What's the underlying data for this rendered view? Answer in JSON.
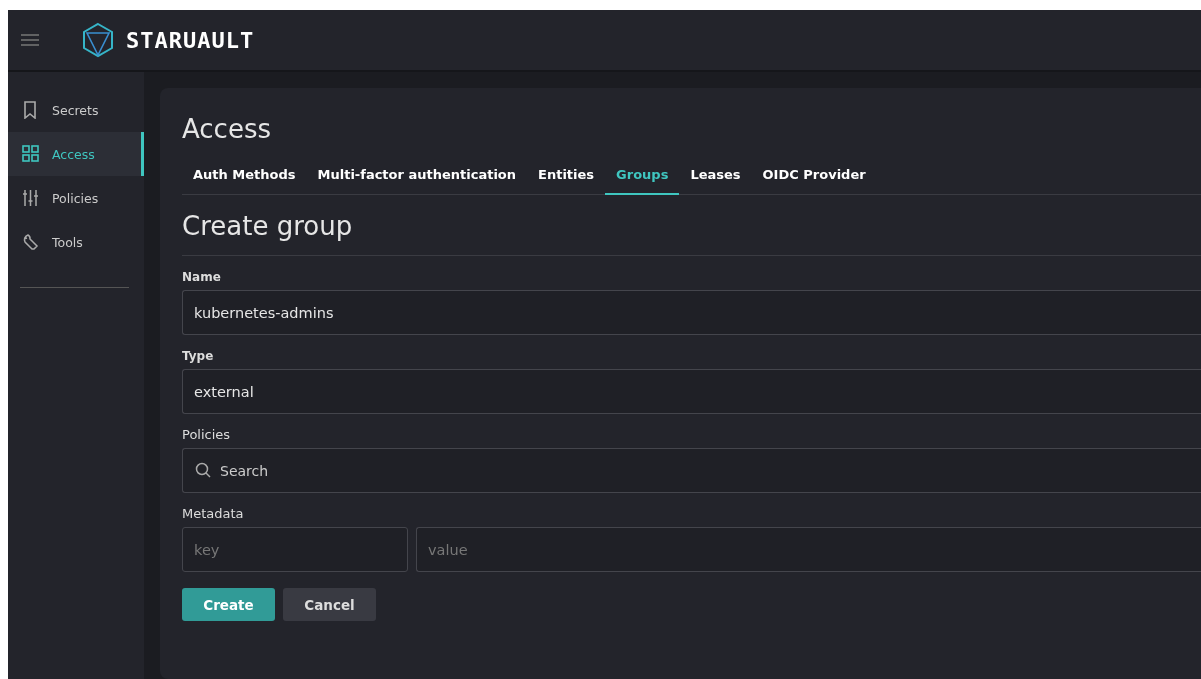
{
  "header": {
    "brand": "STARUAULT"
  },
  "sidebar": {
    "items": [
      {
        "label": "Secrets",
        "selected": false
      },
      {
        "label": "Access",
        "selected": true
      },
      {
        "label": "Policies",
        "selected": false
      },
      {
        "label": "Tools",
        "selected": false
      }
    ]
  },
  "page": {
    "title": "Access",
    "tabs": [
      {
        "label": "Auth Methods",
        "selected": false
      },
      {
        "label": "Multi-factor authentication",
        "selected": false
      },
      {
        "label": "Entities",
        "selected": false
      },
      {
        "label": "Groups",
        "selected": true
      },
      {
        "label": "Leases",
        "selected": false
      },
      {
        "label": "OIDC Provider",
        "selected": false
      }
    ],
    "form": {
      "title": "Create group",
      "fields": [
        {
          "kind": "text",
          "label": "Name",
          "value": "kubernetes-admins"
        },
        {
          "kind": "text",
          "label": "Type",
          "value": "external"
        },
        {
          "kind": "search",
          "label": "Policies",
          "placeholder": "Search"
        },
        {
          "kind": "pair",
          "label": "Metadata",
          "key_placeholder": "key",
          "value_placeholder": "value"
        }
      ],
      "buttons": [
        {
          "label": "Create",
          "kind": "primary"
        },
        {
          "label": "Cancel",
          "kind": "secondary"
        }
      ]
    }
  }
}
